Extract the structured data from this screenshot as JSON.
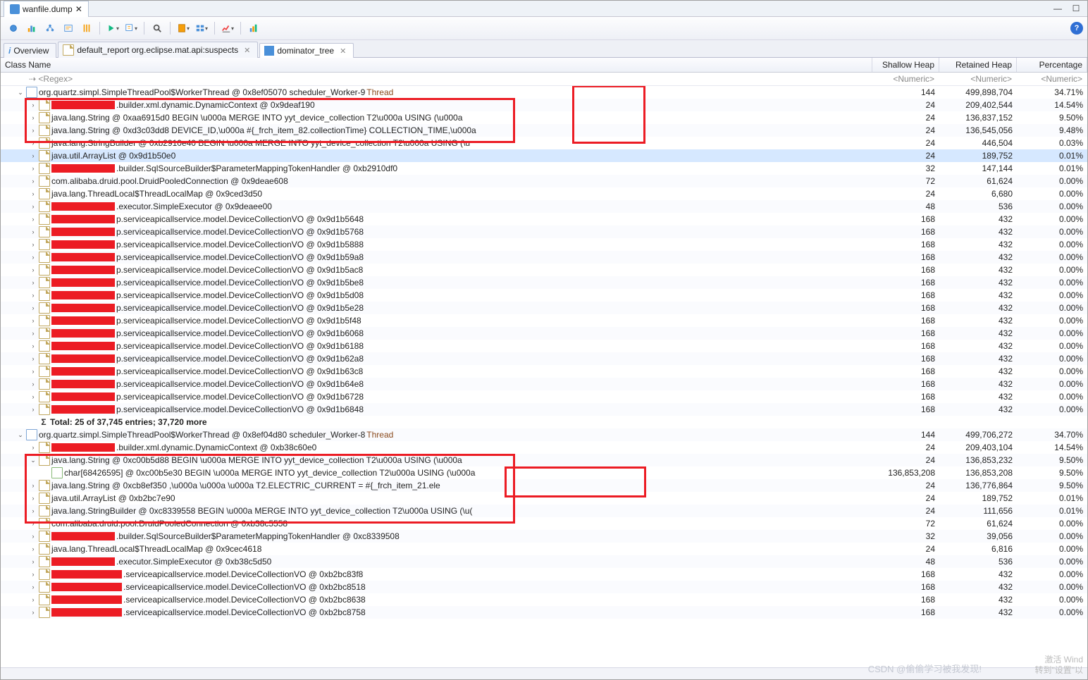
{
  "title_tab": "wanfile.dump",
  "window_buttons": {
    "min": "—",
    "max": "☐"
  },
  "toolbar_icons": [
    "chart-bar-icon",
    "chart-line-icon",
    "chart-pie-icon",
    "sep",
    "play-menu-icon",
    "query-menu-icon",
    "sep",
    "search-icon",
    "sep",
    "folder-menu-icon",
    "table-menu-icon",
    "sep",
    "chart-edit-icon",
    "sep",
    "grid-icon"
  ],
  "help_label": "?",
  "view_tabs": [
    {
      "icon": "i",
      "label": "Overview",
      "closable": false
    },
    {
      "icon": "doc",
      "label": "default_report  org.eclipse.mat.api:suspects",
      "closable": true
    },
    {
      "icon": "tree",
      "label": "dominator_tree",
      "closable": true,
      "active": true
    }
  ],
  "columns": {
    "name": "Class Name",
    "shallow": "Shallow Heap",
    "retained": "Retained Heap",
    "percent": "Percentage"
  },
  "filter": {
    "name": "<Regex>",
    "shallow": "<Numeric>",
    "retained": "<Numeric>",
    "percent": "<Numeric>"
  },
  "totals": "Total: 25 of 37,745 entries; 37,720 more",
  "watermark": {
    "l1": "激活 Wind",
    "l2": "转到\"设置\"以"
  },
  "csdn": "CSDN @偷偷学习被我发现!",
  "rows": [
    {
      "d": 0,
      "e": "open",
      "ico": "class",
      "red": 0,
      "txt": "org.quartz.simpl.SimpleThreadPool$WorkerThread @ 0x8ef05070  scheduler_Worker-9 ",
      "suffix": "Thread",
      "s": "144",
      "r": "499,898,704",
      "p": "34.71%"
    },
    {
      "d": 1,
      "e": "close",
      "ico": "file",
      "red": 90,
      "txt": ".builder.xml.dynamic.DynamicContext @ 0x9deaf190",
      "s": "24",
      "r": "209,402,544",
      "p": "14.54%"
    },
    {
      "d": 1,
      "e": "close",
      "ico": "file",
      "red": 0,
      "txt": "java.lang.String @ 0xaa6915d0   BEGIN   \\u000a                  MERGE INTO yyt_device_collection T2\\u000a                  USING (\\u000a",
      "s": "24",
      "r": "136,837,152",
      "p": "9.50%"
    },
    {
      "d": 1,
      "e": "close",
      "ico": "file",
      "red": 0,
      "txt": "java.lang.String @ 0xd3c03dd8     DEVICE_ID,\\u000a                #{_frch_item_82.collectionTime}  COLLECTION_TIME,\\u000a",
      "s": "24",
      "r": "136,545,056",
      "p": "9.48%"
    },
    {
      "d": 1,
      "e": "close",
      "ico": "file",
      "red": 0,
      "txt": "java.lang.StringBuilder @ 0xb2910e40   BEGIN   \\u000a                  MERGE INTO yyt_device_collection T2\\u000a                  USING (\\u",
      "s": "24",
      "r": "446,504",
      "p": "0.03%"
    },
    {
      "d": 1,
      "e": "close",
      "ico": "file",
      "red": 0,
      "txt": "java.util.ArrayList @ 0x9d1b50e0",
      "s": "24",
      "r": "189,752",
      "p": "0.01%",
      "sel": true
    },
    {
      "d": 1,
      "e": "close",
      "ico": "file",
      "red": 90,
      "txt": ".builder.SqlSourceBuilder$ParameterMappingTokenHandler @ 0xb2910df0",
      "s": "32",
      "r": "147,144",
      "p": "0.01%"
    },
    {
      "d": 1,
      "e": "close",
      "ico": "file",
      "red": 0,
      "txt": "com.alibaba.druid.pool.DruidPooledConnection @ 0x9deae608",
      "s": "72",
      "r": "61,624",
      "p": "0.00%"
    },
    {
      "d": 1,
      "e": "close",
      "ico": "file",
      "red": 0,
      "txt": "java.lang.ThreadLocal$ThreadLocalMap @ 0x9ced3d50",
      "s": "24",
      "r": "6,680",
      "p": "0.00%"
    },
    {
      "d": 1,
      "e": "close",
      "ico": "file",
      "red": 90,
      "txt": ".executor.SimpleExecutor @ 0x9deaee00",
      "s": "48",
      "r": "536",
      "p": "0.00%"
    },
    {
      "d": 1,
      "e": "close",
      "ico": "file",
      "red": 90,
      "txt": "p.serviceapicallservice.model.DeviceCollectionVO @ 0x9d1b5648",
      "s": "168",
      "r": "432",
      "p": "0.00%"
    },
    {
      "d": 1,
      "e": "close",
      "ico": "file",
      "red": 90,
      "txt": "p.serviceapicallservice.model.DeviceCollectionVO @ 0x9d1b5768",
      "s": "168",
      "r": "432",
      "p": "0.00%"
    },
    {
      "d": 1,
      "e": "close",
      "ico": "file",
      "red": 90,
      "txt": "p.serviceapicallservice.model.DeviceCollectionVO @ 0x9d1b5888",
      "s": "168",
      "r": "432",
      "p": "0.00%"
    },
    {
      "d": 1,
      "e": "close",
      "ico": "file",
      "red": 90,
      "txt": "p.serviceapicallservice.model.DeviceCollectionVO @ 0x9d1b59a8",
      "s": "168",
      "r": "432",
      "p": "0.00%"
    },
    {
      "d": 1,
      "e": "close",
      "ico": "file",
      "red": 90,
      "txt": "p.serviceapicallservice.model.DeviceCollectionVO @ 0x9d1b5ac8",
      "s": "168",
      "r": "432",
      "p": "0.00%"
    },
    {
      "d": 1,
      "e": "close",
      "ico": "file",
      "red": 90,
      "txt": "p.serviceapicallservice.model.DeviceCollectionVO @ 0x9d1b5be8",
      "s": "168",
      "r": "432",
      "p": "0.00%"
    },
    {
      "d": 1,
      "e": "close",
      "ico": "file",
      "red": 90,
      "txt": "p.serviceapicallservice.model.DeviceCollectionVO @ 0x9d1b5d08",
      "s": "168",
      "r": "432",
      "p": "0.00%"
    },
    {
      "d": 1,
      "e": "close",
      "ico": "file",
      "red": 90,
      "txt": "p.serviceapicallservice.model.DeviceCollectionVO @ 0x9d1b5e28",
      "s": "168",
      "r": "432",
      "p": "0.00%"
    },
    {
      "d": 1,
      "e": "close",
      "ico": "file",
      "red": 90,
      "txt": "p.serviceapicallservice.model.DeviceCollectionVO @ 0x9d1b5f48",
      "s": "168",
      "r": "432",
      "p": "0.00%"
    },
    {
      "d": 1,
      "e": "close",
      "ico": "file",
      "red": 90,
      "txt": "p.serviceapicallservice.model.DeviceCollectionVO @ 0x9d1b6068",
      "s": "168",
      "r": "432",
      "p": "0.00%"
    },
    {
      "d": 1,
      "e": "close",
      "ico": "file",
      "red": 90,
      "txt": "p.serviceapicallservice.model.DeviceCollectionVO @ 0x9d1b6188",
      "s": "168",
      "r": "432",
      "p": "0.00%"
    },
    {
      "d": 1,
      "e": "close",
      "ico": "file",
      "red": 90,
      "txt": "p.serviceapicallservice.model.DeviceCollectionVO @ 0x9d1b62a8",
      "s": "168",
      "r": "432",
      "p": "0.00%"
    },
    {
      "d": 1,
      "e": "close",
      "ico": "file",
      "red": 90,
      "txt": "p.serviceapicallservice.model.DeviceCollectionVO @ 0x9d1b63c8",
      "s": "168",
      "r": "432",
      "p": "0.00%"
    },
    {
      "d": 1,
      "e": "close",
      "ico": "file",
      "red": 90,
      "txt": "p.serviceapicallservice.model.DeviceCollectionVO @ 0x9d1b64e8",
      "s": "168",
      "r": "432",
      "p": "0.00%"
    },
    {
      "d": 1,
      "e": "close",
      "ico": "file",
      "red": 90,
      "txt": "p.serviceapicallservice.model.DeviceCollectionVO @ 0x9d1b6728",
      "s": "168",
      "r": "432",
      "p": "0.00%"
    },
    {
      "d": 1,
      "e": "close",
      "ico": "file",
      "red": 90,
      "txt": "p.serviceapicallservice.model.DeviceCollectionVO @ 0x9d1b6848",
      "s": "168",
      "r": "432",
      "p": "0.00%"
    },
    {
      "d": 1,
      "e": "sigma",
      "ico": "sigma",
      "red": 0,
      "txt": "Total: 25 of 37,745 entries; 37,720 more",
      "s": "",
      "r": "",
      "p": ""
    },
    {
      "d": 0,
      "e": "open",
      "ico": "class",
      "red": 0,
      "txt": "org.quartz.simpl.SimpleThreadPool$WorkerThread @ 0x8ef04d80  scheduler_Worker-8 ",
      "suffix": "Thread",
      "s": "144",
      "r": "499,706,272",
      "p": "34.70%"
    },
    {
      "d": 1,
      "e": "close",
      "ico": "file",
      "red": 90,
      "txt": ".builder.xml.dynamic.DynamicContext @ 0xb38c60e0",
      "s": "24",
      "r": "209,403,104",
      "p": "14.54%"
    },
    {
      "d": 1,
      "e": "open",
      "ico": "file",
      "red": 0,
      "txt": "java.lang.String @ 0xc00b5d88   BEGIN   \\u000a                  MERGE INTO yyt_device_collection T2\\u000a                  USING (\\u000a",
      "s": "24",
      "r": "136,853,232",
      "p": "9.50%"
    },
    {
      "d": 2,
      "e": "none",
      "ico": "array",
      "red": 0,
      "txt": "char[68426595] @ 0xc00b5e30   BEGIN   \\u000a                  MERGE INTO yyt_device_collection T2\\u000a                  USING (\\u000a",
      "s": "136,853,208",
      "r": "136,853,208",
      "p": "9.50%"
    },
    {
      "d": 1,
      "e": "close",
      "ico": "file",
      "red": 0,
      "txt": "java.lang.String @ 0xcb8ef350   ,\\u000a               \\u000a               \\u000a                  T2.ELECTRIC_CURRENT = #{_frch_item_21.ele",
      "s": "24",
      "r": "136,776,864",
      "p": "9.50%"
    },
    {
      "d": 1,
      "e": "close",
      "ico": "file",
      "red": 0,
      "txt": "java.util.ArrayList @ 0xb2bc7e90",
      "s": "24",
      "r": "189,752",
      "p": "0.01%"
    },
    {
      "d": 1,
      "e": "close",
      "ico": "file",
      "red": 0,
      "txt": "java.lang.StringBuilder @ 0xc8339558   BEGIN   \\u000a                  MERGE INTO yyt_device_collection T2\\u000a                  USING (\\u(",
      "s": "24",
      "r": "111,656",
      "p": "0.01%"
    },
    {
      "d": 1,
      "e": "close",
      "ico": "file",
      "red": 0,
      "txt": "com.alibaba.druid.pool.DruidPooledConnection @ 0xb38c5558",
      "s": "72",
      "r": "61,624",
      "p": "0.00%"
    },
    {
      "d": 1,
      "e": "close",
      "ico": "file",
      "red": 90,
      "txt": ".builder.SqlSourceBuilder$ParameterMappingTokenHandler @ 0xc8339508",
      "s": "32",
      "r": "39,056",
      "p": "0.00%"
    },
    {
      "d": 1,
      "e": "close",
      "ico": "file",
      "red": 0,
      "txt": "java.lang.ThreadLocal$ThreadLocalMap @ 0x9cec4618",
      "s": "24",
      "r": "6,816",
      "p": "0.00%"
    },
    {
      "d": 1,
      "e": "close",
      "ico": "file",
      "red": 90,
      "txt": ".executor.SimpleExecutor @ 0xb38c5d50",
      "s": "48",
      "r": "536",
      "p": "0.00%"
    },
    {
      "d": 1,
      "e": "close",
      "ico": "file",
      "red": 100,
      "txt": ".serviceapicallservice.model.DeviceCollectionVO @ 0xb2bc83f8",
      "s": "168",
      "r": "432",
      "p": "0.00%"
    },
    {
      "d": 1,
      "e": "close",
      "ico": "file",
      "red": 100,
      "txt": ".serviceapicallservice.model.DeviceCollectionVO @ 0xb2bc8518",
      "s": "168",
      "r": "432",
      "p": "0.00%"
    },
    {
      "d": 1,
      "e": "close",
      "ico": "file",
      "red": 100,
      "txt": ".serviceapicallservice.model.DeviceCollectionVO @ 0xb2bc8638",
      "s": "168",
      "r": "432",
      "p": "0.00%"
    },
    {
      "d": 1,
      "e": "close",
      "ico": "file",
      "red": 100,
      "txt": ".serviceapicallservice.model.DeviceCollectionVO @ 0xb2bc8758",
      "s": "168",
      "r": "432",
      "p": "0.00%"
    }
  ]
}
